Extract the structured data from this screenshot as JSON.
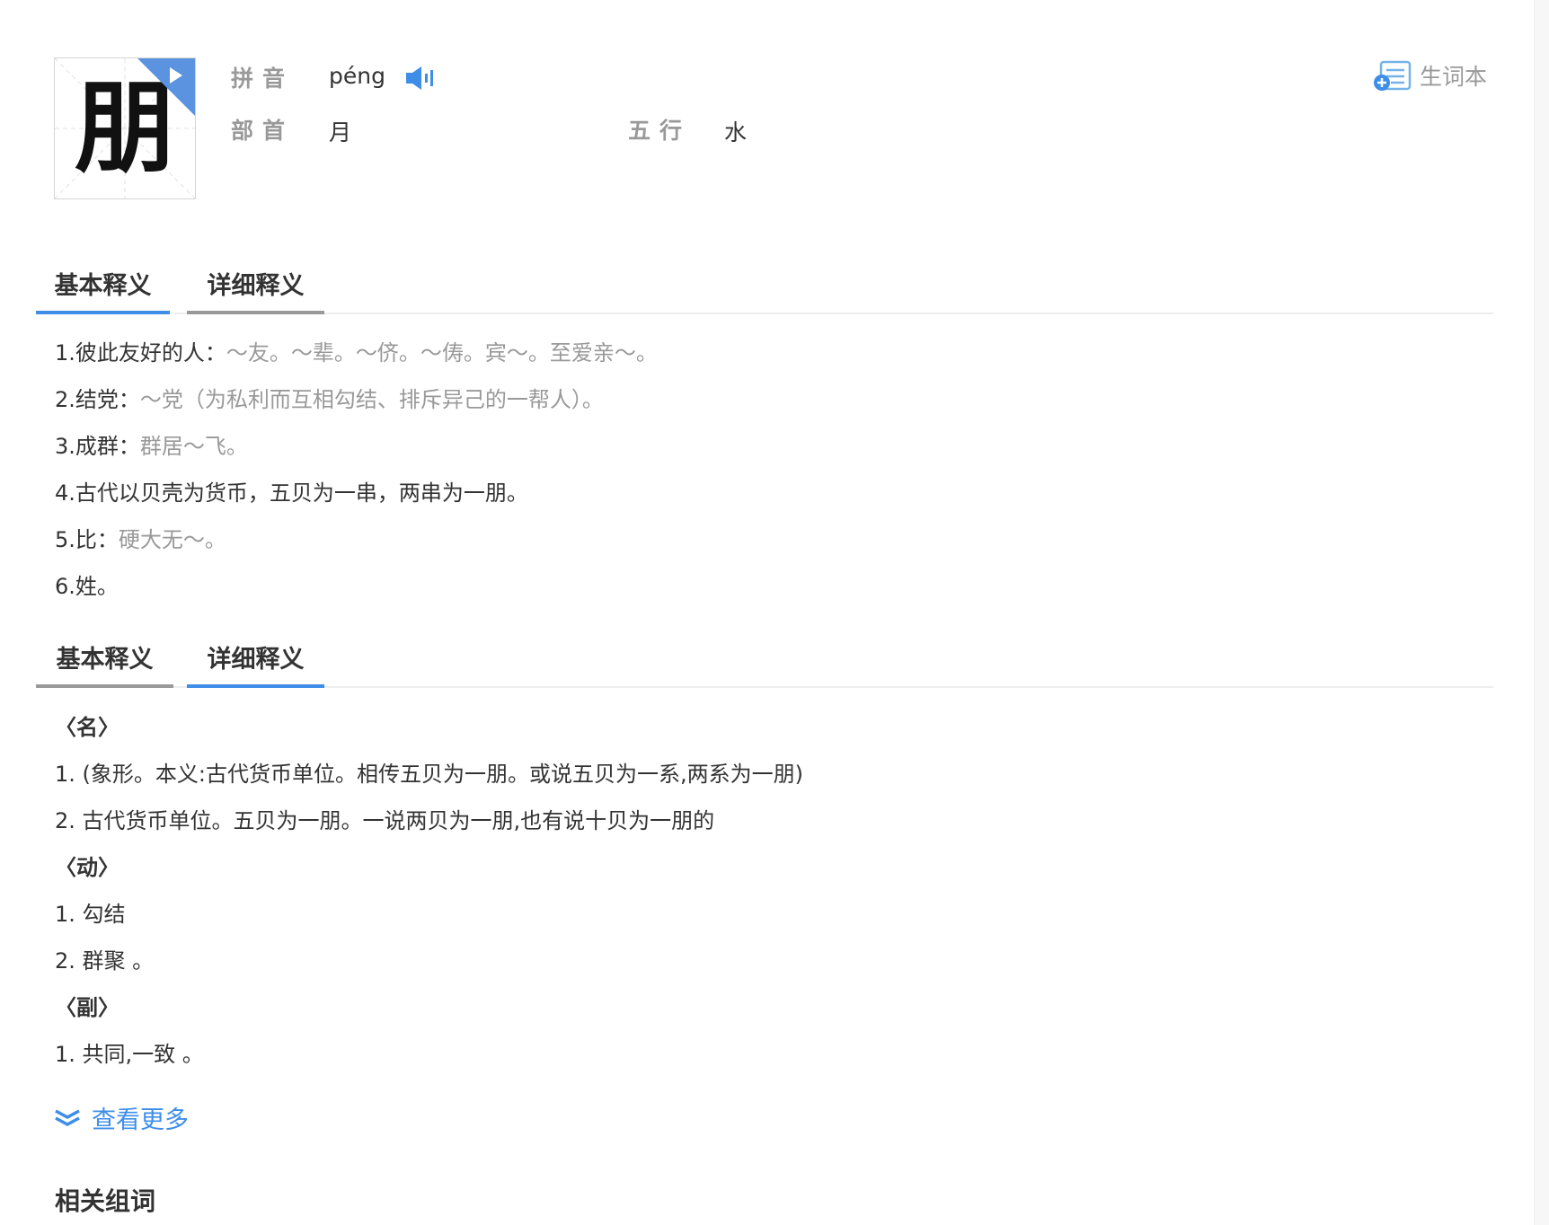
{
  "character": "朋",
  "info": {
    "pinyin_label": "拼音",
    "pinyin": "péng",
    "radical_label": "部首",
    "radical": "月",
    "wuxing_label": "五行",
    "wuxing": "水"
  },
  "vocab_button": {
    "label": "生词本",
    "icon": "vocabulary-add-icon"
  },
  "tabs_basic": [
    {
      "label": "基本释义",
      "active": true
    },
    {
      "label": "详细释义",
      "active": false
    }
  ],
  "basic_definitions": [
    {
      "main": "1.彼此友好的人：",
      "example": "～友。～辈。～侪。～俦。宾～。至爱亲～。"
    },
    {
      "main": "2.结党：",
      "example": "～党（为私利而互相勾结、排斥异己的一帮人）。"
    },
    {
      "main": "3.成群：",
      "example": "群居～飞。"
    },
    {
      "main": "4.古代以贝壳为货币，五贝为一串，两串为一朋。",
      "example": ""
    },
    {
      "main": "5.比：",
      "example": "硬大无～。"
    },
    {
      "main": "6.姓。",
      "example": ""
    }
  ],
  "tabs_detail": [
    {
      "label": "基本释义",
      "active": false
    },
    {
      "label": "详细释义",
      "active": true
    }
  ],
  "detailed_definitions": [
    {
      "type": "pos",
      "text": "〈名〉"
    },
    {
      "type": "def",
      "text": "1. (象形。本义:古代货币单位。相传五贝为一朋。或说五贝为一系,两系为一朋)"
    },
    {
      "type": "def",
      "text": "2. 古代货币单位。五贝为一朋。一说两贝为一朋,也有说十贝为一朋的"
    },
    {
      "type": "pos",
      "text": "〈动〉"
    },
    {
      "type": "def",
      "text": "1. 勾结"
    },
    {
      "type": "def",
      "text": "2. 群聚 。"
    },
    {
      "type": "pos",
      "text": "〈副〉"
    },
    {
      "type": "def",
      "text": "1. 共同,一致 。"
    }
  ],
  "more_link": {
    "label": "查看更多",
    "icon": "double-chevron-down-icon"
  },
  "related_title": "相关组词",
  "colors": {
    "accent": "#3e8ee8",
    "muted": "#999999",
    "text": "#333333",
    "corner": "#5b93e0"
  }
}
